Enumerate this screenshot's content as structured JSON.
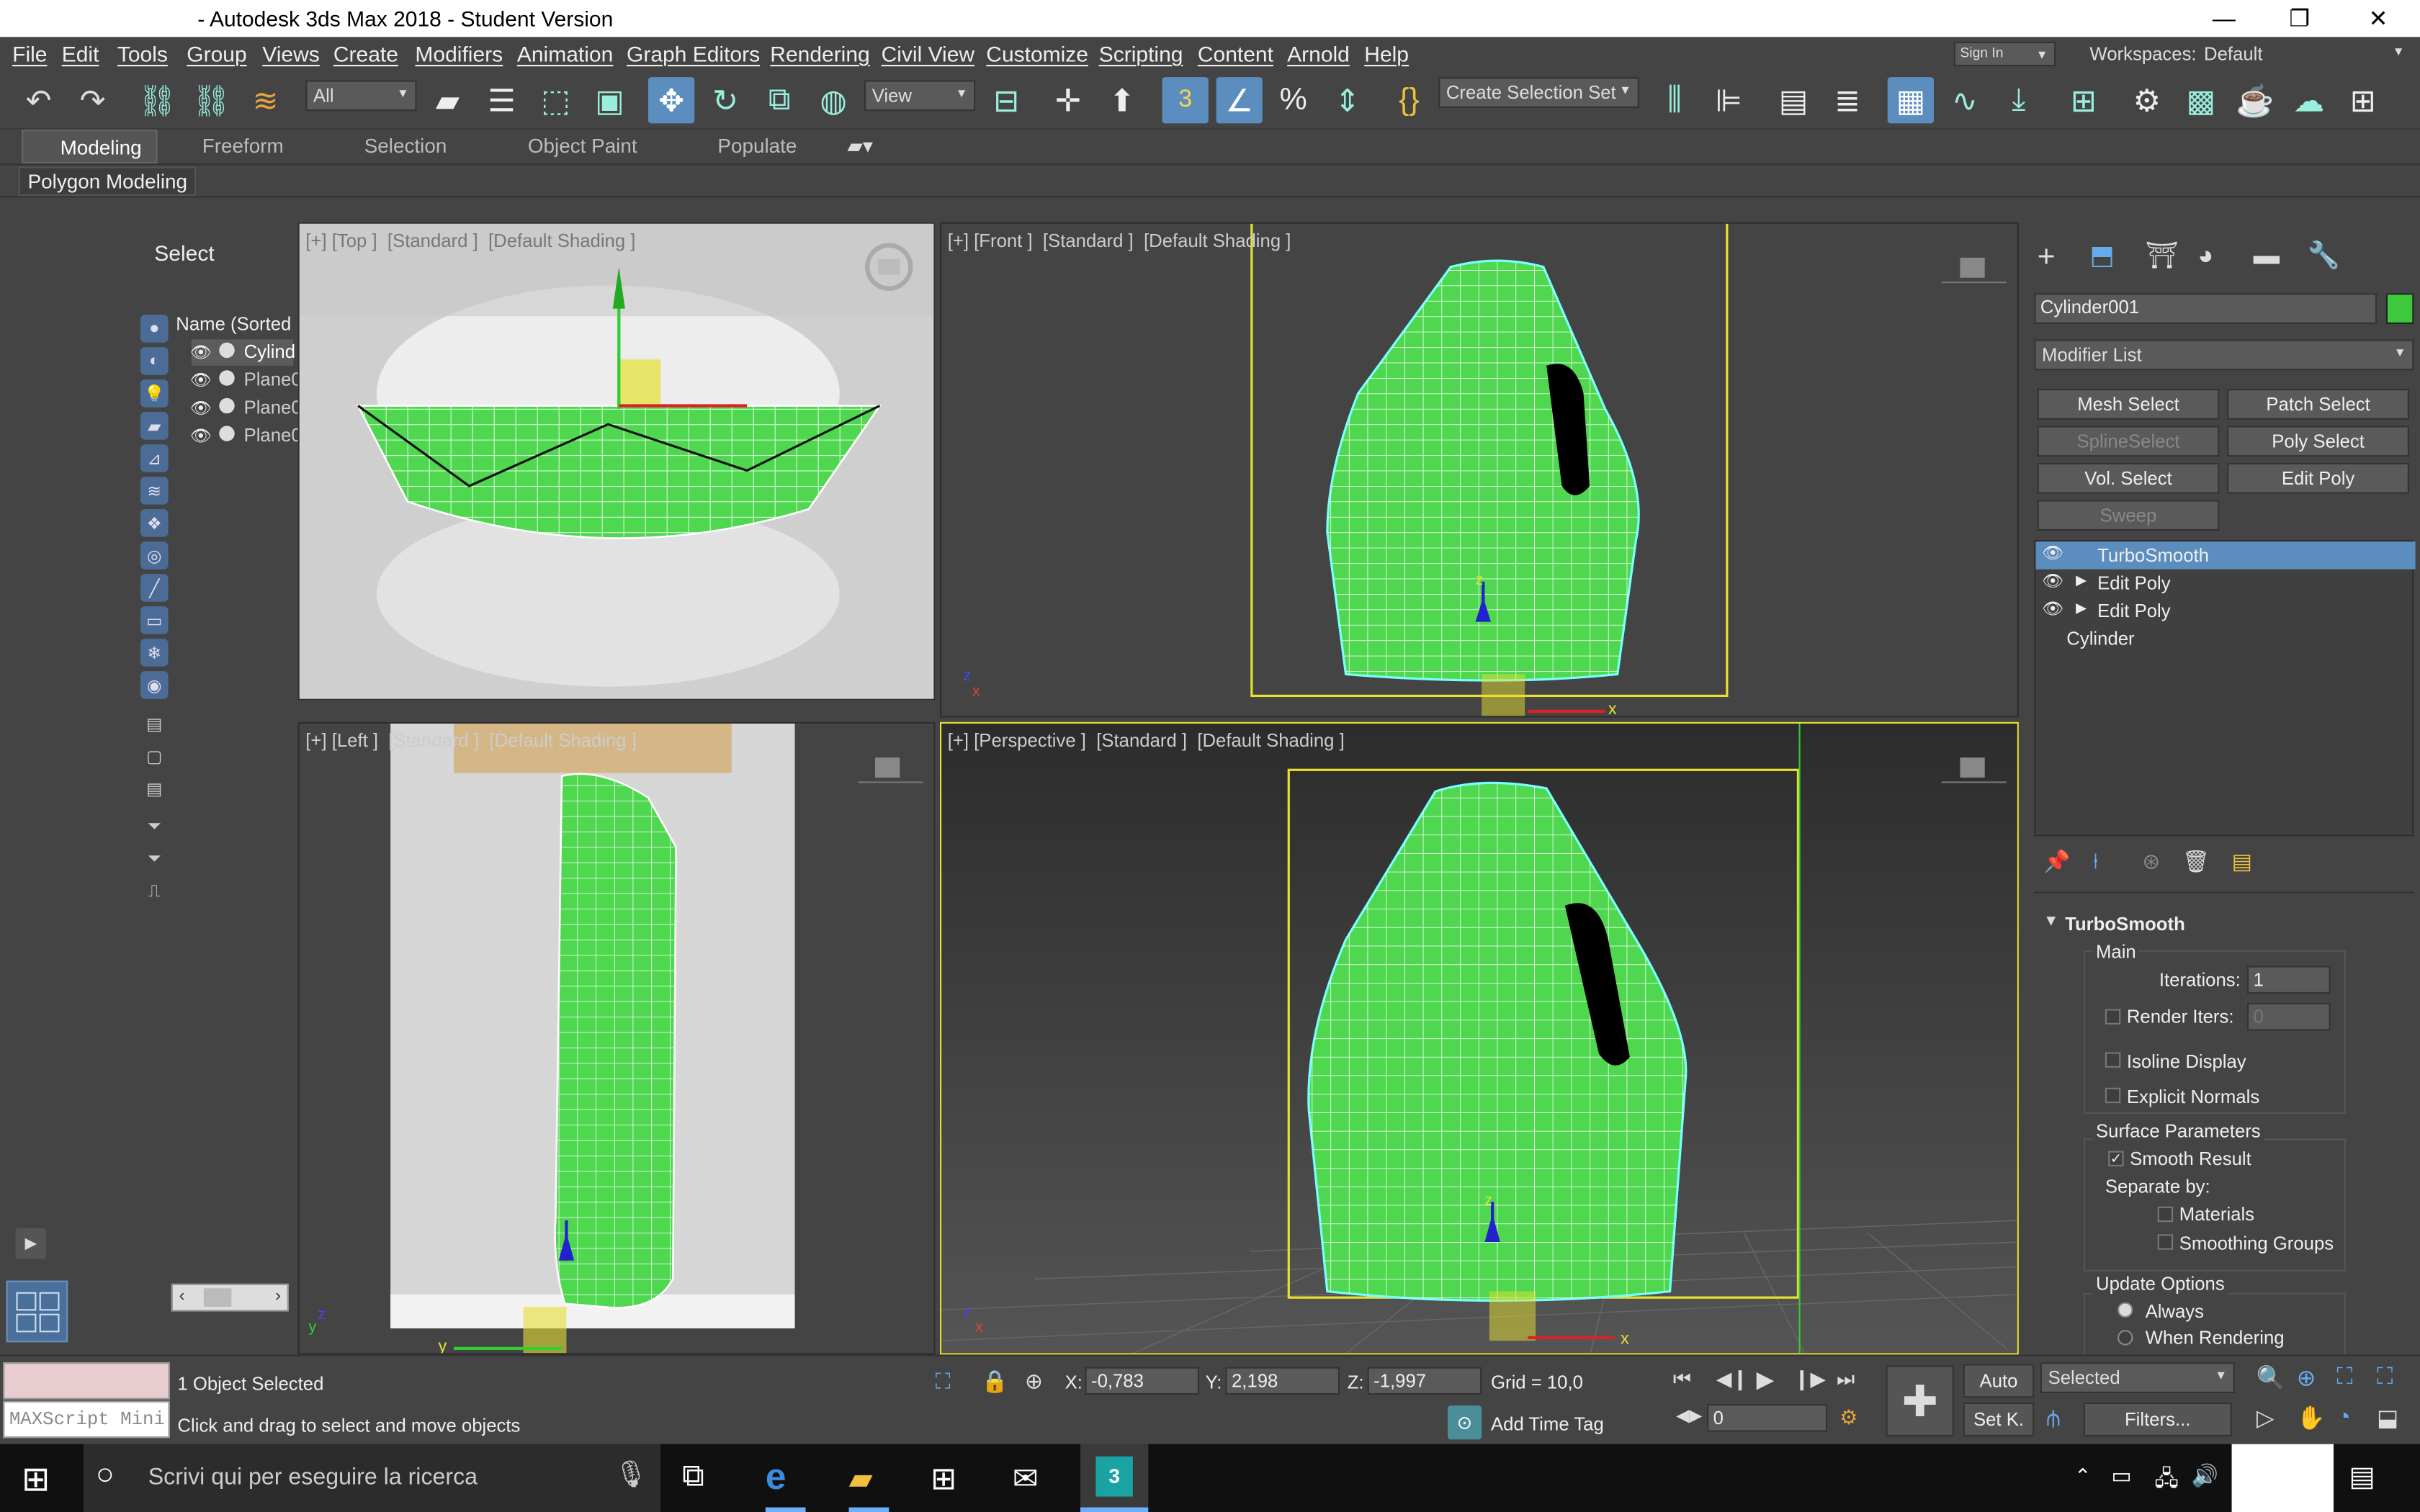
{
  "window": {
    "title": "- Autodesk 3ds Max 2018 - Student Version"
  },
  "menu": [
    "File",
    "Edit",
    "Tools",
    "Group",
    "Views",
    "Create",
    "Modifiers",
    "Animation",
    "Graph Editors",
    "Rendering",
    "Civil View",
    "Customize",
    "Scripting",
    "Content",
    "Arnold",
    "Help"
  ],
  "account": {
    "sign_in": "Sign In",
    "workspaces_label": "Workspaces:",
    "workspace": "Default"
  },
  "toolbar": {
    "filter": "All",
    "ref_coord": "View",
    "selection_set": "Create Selection Set"
  },
  "ribbon": {
    "tabs": [
      "Modeling",
      "Freeform",
      "Selection",
      "Object Paint",
      "Populate"
    ],
    "active": "Modeling",
    "panel": "Polygon Modeling"
  },
  "scene_explorer": {
    "select_label": "Select",
    "column": "Name (Sorted",
    "items": [
      "Cylind",
      "Plane0",
      "Plane0",
      "Plane0"
    ]
  },
  "viewports": {
    "top": "[+] [Top ]  [Standard ]  [Default Shading ]",
    "front": "[+] [Front ]  [Standard ]  [Default Shading ]",
    "left": "[+] [Left ]  [Standard ]  [Default Shading ]",
    "perspective": "[+] [Perspective ]  [Standard ]  [Default Shading ]"
  },
  "command_panel": {
    "object_name": "Cylinder001",
    "object_color": "#3ec83e",
    "modifier_list": "Modifier List",
    "buttons": [
      "Mesh Select",
      "Patch Select",
      "SplineSelect",
      "Poly Select",
      "Vol. Select",
      "Edit Poly",
      "Sweep"
    ],
    "stack": [
      "TurboSmooth",
      "Edit Poly",
      "Edit Poly",
      "Cylinder"
    ],
    "rollout": {
      "title": "TurboSmooth",
      "main": "Main",
      "iterations_label": "Iterations:",
      "iterations": "1",
      "render_iters_label": "Render Iters:",
      "render_iters": "0",
      "isoline": "Isoline Display",
      "explicit_normals": "Explicit Normals",
      "surface_params": "Surface Parameters",
      "smooth_result": "Smooth Result",
      "separate_by": "Separate by:",
      "materials": "Materials",
      "smoothing_groups": "Smoothing Groups",
      "update_options": "Update Options",
      "always": "Always",
      "when_rendering": "When Rendering"
    }
  },
  "status": {
    "maxscript": "MAXScript Mini",
    "selected": "1 Object Selected",
    "hint": "Click and drag to select and move objects",
    "x_label": "X:",
    "x": "-0,783",
    "y_label": "Y:",
    "y": "2,198",
    "z_label": "Z:",
    "z": "-1,997",
    "grid": "Grid = 10,0",
    "add_time_tag": "Add Time Tag",
    "frame": "0",
    "auto": "Auto",
    "set_key": "Set K.",
    "selected_dd": "Selected",
    "filters": "Filters..."
  },
  "taskbar": {
    "search": "Scrivi qui per eseguire la ricerca"
  },
  "colors": {
    "accent": "#5b8dbf",
    "mesh": "#4fd84f",
    "selection": "#e6e030"
  }
}
